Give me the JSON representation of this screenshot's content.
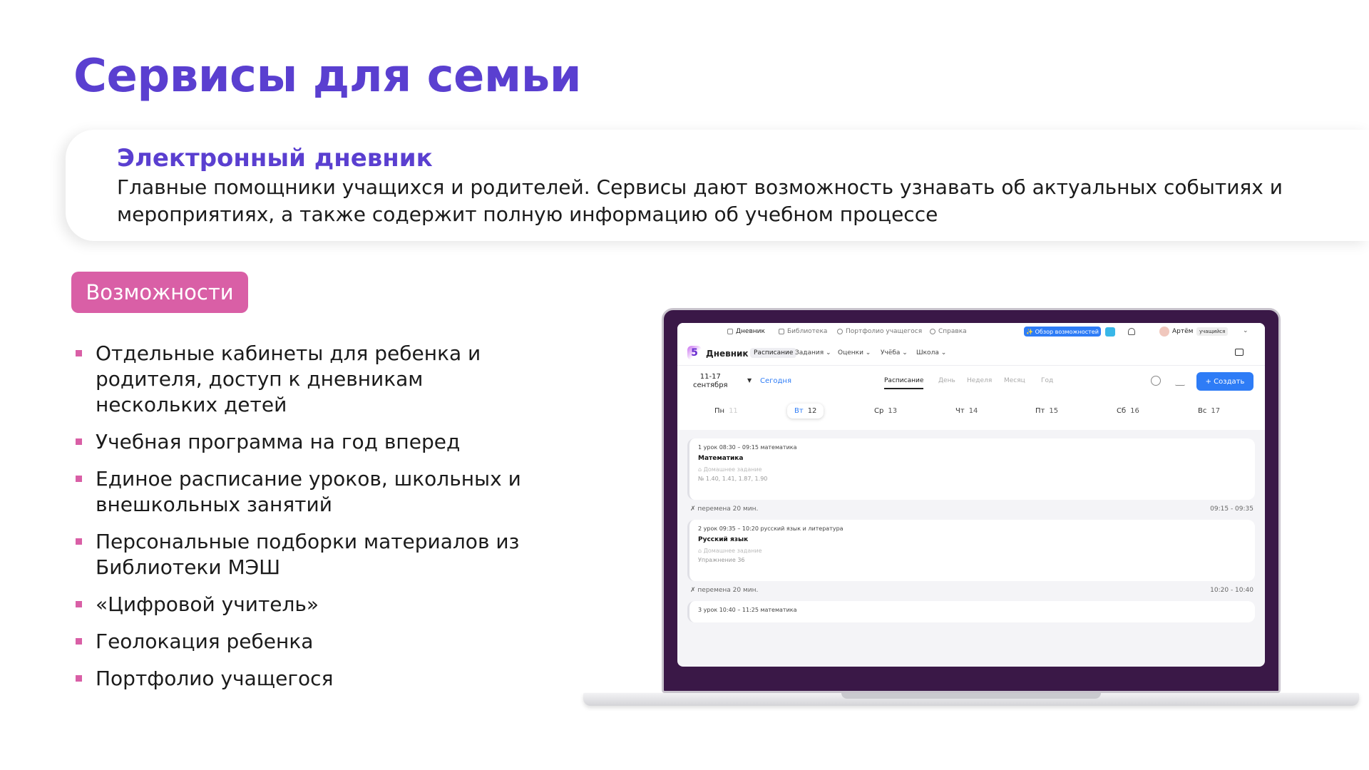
{
  "slide": {
    "title": "Сервисы для семьи",
    "card_title": "Электронный дневник",
    "card_text": "Главные помощники учащихся и родителей. Сервисы дают возможность узнавать об актуальных событиях и мероприятиях, а также содержит полную информацию об учебном процессе",
    "badge": "Возможности",
    "features": [
      "Отдельные кабинеты для ребенка и родителя, доступ к дневникам нескольких детей",
      "Учебная программа на год вперед",
      "Единое расписание уроков, школьных и внешкольных занятий",
      "Персональные подборки материалов из Библиотеки МЭШ",
      "«Цифровой учитель»",
      "Геолокация ребенка",
      "Портфолио учащегося"
    ]
  },
  "screen": {
    "topbar": {
      "items": [
        "Дневник",
        "Библиотека",
        "Портфолио учащегося",
        "Справка"
      ],
      "overview_button": "✨ Обзор возможностей",
      "user_name": "Артём",
      "user_role": "учащийся"
    },
    "navbar": {
      "logo": "5",
      "app_name": "Дневник",
      "items": [
        "Расписание",
        "Задания ⌄",
        "Оценки ⌄",
        "Учёба ⌄",
        "Школа ⌄"
      ]
    },
    "toolbar": {
      "date_range_line1": "11-17",
      "date_range_line2": "сентября",
      "today": "Сегодня",
      "views": [
        "Расписание",
        "День",
        "Неделя",
        "Месяц",
        "Год"
      ],
      "create_button": "+ Создать"
    },
    "days": [
      {
        "name": "Пн",
        "num": "11"
      },
      {
        "name": "Вт",
        "num": "12"
      },
      {
        "name": "Ср",
        "num": "13"
      },
      {
        "name": "Чт",
        "num": "14"
      },
      {
        "name": "Пт",
        "num": "15"
      },
      {
        "name": "Сб",
        "num": "16"
      },
      {
        "name": "Вс",
        "num": "17"
      }
    ],
    "lessons": [
      {
        "head": "1 урок 08:30 – 09:15 математика",
        "subject": "Математика",
        "hw_label": "Домашнее задание",
        "hw": "№ 1.40, 1.41, 1.87, 1.90"
      },
      {
        "head": "2 урок 09:35 – 10:20 русский язык и литература",
        "subject": "Русский язык",
        "hw_label": "Домашнее задание",
        "hw": "Упражнение 36"
      },
      {
        "head": "3 урок 10:40 – 11:25 математика"
      }
    ],
    "breaks": [
      {
        "label": "перемена 20 мин.",
        "time": "09:15 - 09:35"
      },
      {
        "label": "перемена 20 мин.",
        "time": "10:20 - 10:40"
      }
    ]
  }
}
